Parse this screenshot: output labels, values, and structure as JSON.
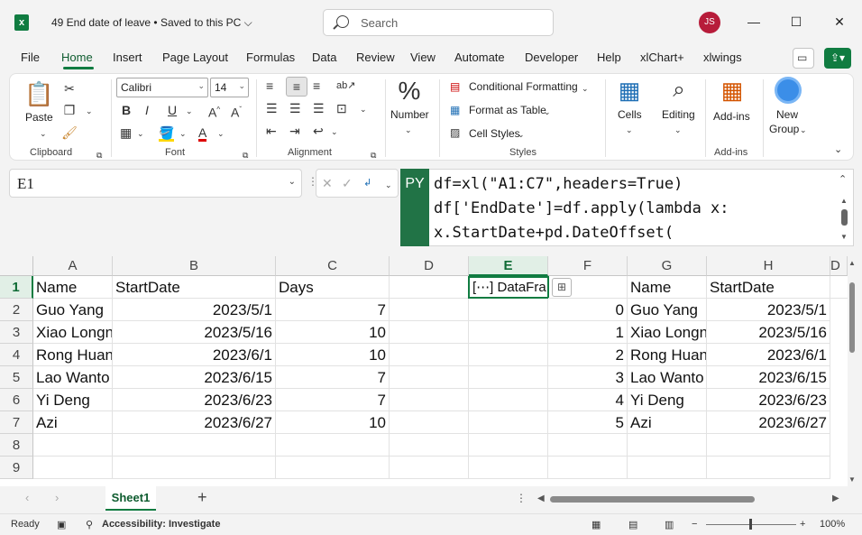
{
  "titlebar": {
    "app_icon": "excel-logo",
    "doc_title": "49 End date of leave • Saved to this PC ⌵",
    "search_placeholder": "Search",
    "avatar_initials": "JS"
  },
  "menu": {
    "tabs": [
      "File",
      "Home",
      "Insert",
      "Page Layout",
      "Formulas",
      "Data",
      "Review",
      "View",
      "Automate",
      "Developer",
      "Help",
      "xlChart+",
      "xlwings"
    ],
    "active_tab": "Home"
  },
  "ribbon": {
    "clipboard": {
      "paste": "Paste",
      "group": "Clipboard"
    },
    "font": {
      "name": "Calibri",
      "size": "14",
      "bold": "B",
      "italic": "I",
      "underline": "U",
      "group": "Font"
    },
    "alignment": {
      "group": "Alignment"
    },
    "number": {
      "label": "Number",
      "symbol": "%"
    },
    "styles": {
      "conditional": "Conditional Formatting",
      "format_table": "Format as Table",
      "cell_styles": "Cell Styles",
      "group": "Styles"
    },
    "cells": {
      "label": "Cells"
    },
    "editing": {
      "label": "Editing"
    },
    "addins": {
      "label": "Add-ins",
      "group": "Add-ins"
    },
    "newgroup": {
      "label1": "New",
      "label2": "Group"
    }
  },
  "formula_bar": {
    "name_box": "E1",
    "badge": "PY",
    "lines": [
      "df=xl(\"A1:C7\",headers=True)",
      "df['EndDate']=df.apply(lambda x:",
      "x.StartDate+pd.DateOffset("
    ]
  },
  "columns": [
    "A",
    "B",
    "C",
    "D",
    "E",
    "F",
    "G",
    "H",
    "D"
  ],
  "rows": [
    "1",
    "2",
    "3",
    "4",
    "5",
    "6",
    "7",
    "8",
    "9"
  ],
  "table": {
    "headers": [
      "Name",
      "StartDate",
      "Days"
    ],
    "data": [
      [
        "Guo Yang",
        "2023/5/1",
        "7"
      ],
      [
        "Xiao Longn",
        "2023/5/16",
        "10"
      ],
      [
        "Rong Huan",
        "2023/6/1",
        "10"
      ],
      [
        "Lao Wanto",
        "2023/6/15",
        "7"
      ],
      [
        "Yi Deng",
        "2023/6/23",
        "7"
      ],
      [
        "Azi",
        "2023/6/27",
        "10"
      ]
    ]
  },
  "dataframe_cell": "[⋯] DataFra",
  "spill": {
    "index": [
      "0",
      "1",
      "2",
      "3",
      "4",
      "5"
    ],
    "headers": [
      "Name",
      "StartDate"
    ],
    "data": [
      [
        "Guo Yang",
        "2023/5/1"
      ],
      [
        "Xiao Longn",
        "2023/5/16"
      ],
      [
        "Rong Huan",
        "2023/6/1"
      ],
      [
        "Lao Wanto",
        "2023/6/15"
      ],
      [
        "Yi Deng",
        "2023/6/23"
      ],
      [
        "Azi",
        "2023/6/27"
      ]
    ]
  },
  "sheets": {
    "active": "Sheet1",
    "add": "+"
  },
  "status": {
    "ready": "Ready",
    "accessibility": "Accessibility: Investigate",
    "zoom": "100%"
  }
}
